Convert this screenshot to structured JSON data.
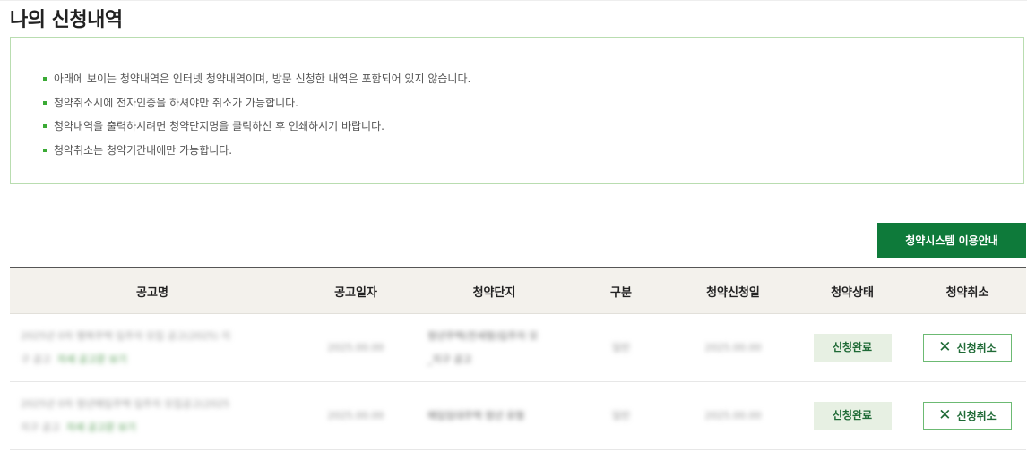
{
  "page": {
    "title": "나의 신청내역"
  },
  "notice": {
    "items": [
      "아래에 보이는 청약내역은 인터넷 청약내역이며, 방문 신청한 내역은 포함되어 있지 않습니다.",
      "청약취소시에 전자인증을 하셔야만 취소가 가능합니다.",
      "청약내역을 출력하시려면 청약단지명을 클릭하신 후 인쇄하시기 바랍니다.",
      "청약취소는 청약기간내에만 가능합니다."
    ]
  },
  "guide_button": {
    "label": "청약시스템 이용안내"
  },
  "table": {
    "headers": [
      "공고명",
      "공고일자",
      "청약단지",
      "구분",
      "청약신청일",
      "청약상태",
      "청약취소"
    ],
    "rows": [
      {
        "notice_name": "2025년 0차 행복주택 입주자 모집 공고(2025) 지",
        "notice_name_line2": "구 공고",
        "notice_link": "자세 공고문 보기",
        "notice_date": "2025.00.00",
        "complex": "청년주택(전세형)입주자 모",
        "complex_line2": "_지구 공고",
        "type": "일반",
        "apply_date": "2025.00.00",
        "status": "신청완료",
        "cancel_label": "신청취소"
      },
      {
        "notice_name": "2025년 0차 청년매입주택 입주자 모집공고(2025",
        "notice_name_line2": "지구 공고",
        "notice_link": "자세 공고문 보기",
        "notice_date": "2025.00.00",
        "complex": "매입임대주택 청년 유형",
        "complex_line2": "",
        "type": "일반",
        "apply_date": "2025.00.00",
        "status": "신청완료",
        "cancel_label": "신청취소"
      }
    ]
  },
  "colors": {
    "accent": "#0e7a3a",
    "notice_border": "#b9ddb0",
    "status_bg": "#e7f0e3"
  }
}
